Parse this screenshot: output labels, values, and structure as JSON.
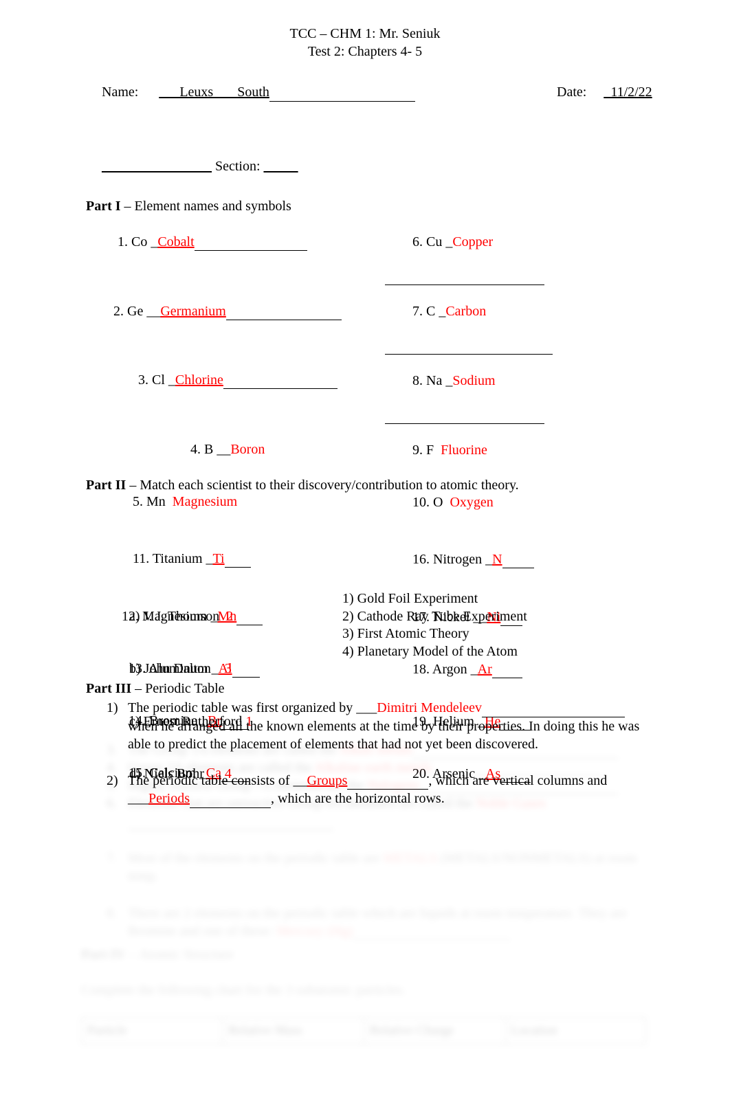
{
  "header": {
    "title": "TCC – CHM 1: Mr. Seniuk",
    "subtitle": "Test 2: Chapters 4- 5",
    "name_label": "Name:",
    "name_value": "___Leuxs       South",
    "date_label": "Date:",
    "date_value": "_11/2/22",
    "section_prefix": "________________",
    "section_label": "Section:",
    "section_value": "_____"
  },
  "accent_color": "#FF0000",
  "partI": {
    "heading_bold": "Part I",
    "heading_rest": " – Element names and symbols",
    "left": [
      {
        "num": "1.",
        "symbol": "Co",
        "lead": "_",
        "answer": "Cobalt",
        "indent": 6
      },
      {
        "num": "2.",
        "symbol": "Ge",
        "lead": "__",
        "answer": "Germanium",
        "indent": 0
      },
      {
        "num": "3.",
        "symbol": "Cl",
        "lead": "_",
        "answer": "Chlorine",
        "indent": 36
      },
      {
        "num": "4.",
        "symbol": "B",
        "lead": "__",
        "answer": "Boron",
        "indent": 112
      },
      {
        "num": "5.",
        "symbol": "Mn",
        "lead": " ",
        "answer": "Magnesium",
        "indent": 28
      },
      {
        "num": "11.",
        "symbol": "Titanium",
        "lead": "_",
        "answer": "Ti",
        "indent": 28
      },
      {
        "num": "12.",
        "symbol": "Magnesium",
        "lead": "_",
        "answer": "Mn",
        "indent": 12
      },
      {
        "num": "13.",
        "symbol": "Aluminum",
        "lead": "_",
        "answer": "Al",
        "indent": 22
      },
      {
        "num": "14.",
        "symbol": "Bromine",
        "lead": "_",
        "answer": "Br",
        "indent": 22
      },
      {
        "num": "15.",
        "symbol": "Calcium",
        "lead": "_",
        "answer": "Ca",
        "indent": 22
      }
    ],
    "right": [
      {
        "num": "6.",
        "symbol": "Cu",
        "lead": "_",
        "answer": "Copper"
      },
      {
        "num": "7.",
        "symbol": "C",
        "lead": "_",
        "answer": "Carbon"
      },
      {
        "num": "8.",
        "symbol": "Na",
        "lead": "_",
        "answer": "Sodium"
      },
      {
        "num": "9.",
        "symbol": "F",
        "lead": " ",
        "answer": "Fluorine"
      },
      {
        "num": "10.",
        "symbol": "O",
        "lead": " ",
        "answer": "Oxygen"
      },
      {
        "num": "16.",
        "symbol": "Nitrogen",
        "lead": "_",
        "answer": "N"
      },
      {
        "num": "17.",
        "symbol": "Nickel",
        "lead": "__",
        "answer": "Ni"
      },
      {
        "num": "18.",
        "symbol": "Argon",
        "lead": "_",
        "answer": "Ar"
      },
      {
        "num": "19.",
        "symbol": "Helium",
        "lead": "_",
        "answer": "He"
      },
      {
        "num": "20.",
        "symbol": "Arsenic",
        "lead": "_",
        "answer": "As"
      }
    ]
  },
  "partII": {
    "heading_bold": "Part II",
    "heading_rest": " – Match each scientist to their discovery/contribution to atomic theory.",
    "scientists": [
      {
        "key": "a)",
        "name": "J. J. Thomson",
        "answer": "2"
      },
      {
        "key": "b)",
        "name": "John Dalton",
        "answer": "3"
      },
      {
        "key": "c)",
        "name": "Ernest Rutherford",
        "answer": "1"
      },
      {
        "key": "d)",
        "name": "Niels Bohr",
        "answer": "4"
      }
    ],
    "discoveries": [
      "1) Gold Foil Experiment",
      "2) Cathode Ray Tube Experiment",
      "3) First Atomic Theory",
      "4) Planetary Model of the Atom"
    ]
  },
  "partIII": {
    "heading_bold": "Part III",
    "heading_rest": " – Periodic Table",
    "q1": {
      "num": "1)",
      "pre": "The periodic table was first organized by ___",
      "answer": "Dimitri Mendeleev",
      "post": " when he arranged all the known elements at the time by their properties.  In doing this he was able to predict the placement of elements that had not yet been discovered."
    },
    "q2": {
      "num": "2)",
      "pre": "The periodic table consists of __",
      "answer1": "Groups",
      "mid": ", which are vertical columns and ___",
      "answer2": "Periods",
      "post": ", which are the horizontal rows."
    }
  },
  "obscured": {
    "note": "Remaining content below is faded/illegible in the screenshot.",
    "q3": {
      "num": "3.",
      "text": "The Group 1A elements are called the",
      "answer": "Alkali metals"
    },
    "q4": {
      "num": "4.",
      "text": "Group 2A elements are called the",
      "answer": "Alkaline earth metals"
    },
    "q5": {
      "num": "5.",
      "text": "Highly reactive Group 7A elements are the",
      "answer": "Halogens"
    },
    "q6": {
      "num": "6.",
      "text": "Elements that are unreactive Group 8A members are called the",
      "answer": "Noble Gases"
    },
    "q7": {
      "num": "7.",
      "text": "Most of the elements on the periodic table are",
      "answer": "METALS",
      "tail": "(METALS/NONMETALS) at room temp."
    },
    "q8": {
      "num": "8.",
      "text": "There are 2 elements on the periodic table which are liquids at room temperature.  They are Bromine and one of these:",
      "answer": "Mercury (Hg)"
    },
    "partIV": {
      "heading_bold": "Part IV",
      "heading_rest": " – Atomic Structure"
    },
    "instruction": "Complete the following chart for the 3 subatomic particles.",
    "table_headers": [
      "Particle",
      "Relative Mass",
      "Relative Charge",
      "Location"
    ]
  }
}
